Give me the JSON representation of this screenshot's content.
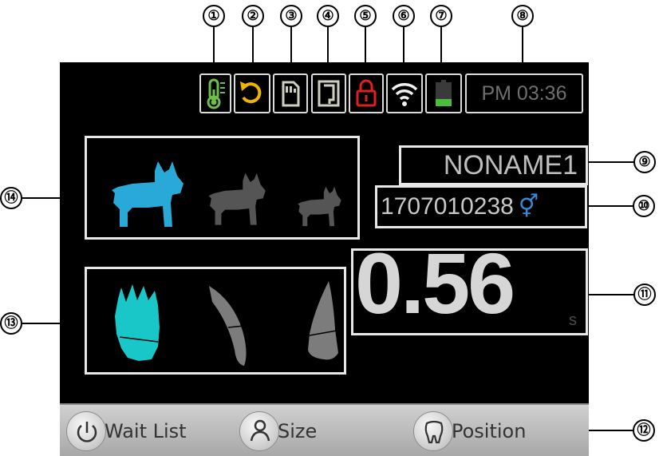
{
  "status_bar": {
    "icons": [
      "thermometer-icon",
      "refresh-icon",
      "sd-card-icon",
      "sensor-icon",
      "lock-icon",
      "wifi-icon",
      "battery-icon"
    ],
    "clock": "PM 03:36"
  },
  "colors": {
    "thermometer": "#6cc04a",
    "refresh": "#f0b400",
    "lock": "#e02020",
    "battery": "#4cbc3c",
    "selected": "#29a9d8",
    "selected_tooth": "#19c6c8"
  },
  "patient": {
    "name": "NONAME1",
    "id": "1707010238",
    "gender_symbol": "⚥"
  },
  "exposure": {
    "value": "0.56",
    "unit": "s"
  },
  "bottom_bar": {
    "wait_list": "Wait List",
    "size": "Size",
    "position": "Position"
  },
  "callouts": {
    "c1": "①",
    "c2": "②",
    "c3": "③",
    "c4": "④",
    "c5": "⑤",
    "c6": "⑥",
    "c7": "⑦",
    "c8": "⑧",
    "c9": "⑨",
    "c10": "⑩",
    "c11": "⑪",
    "c12": "⑫",
    "c13": "⑬",
    "c14": "⑭"
  }
}
